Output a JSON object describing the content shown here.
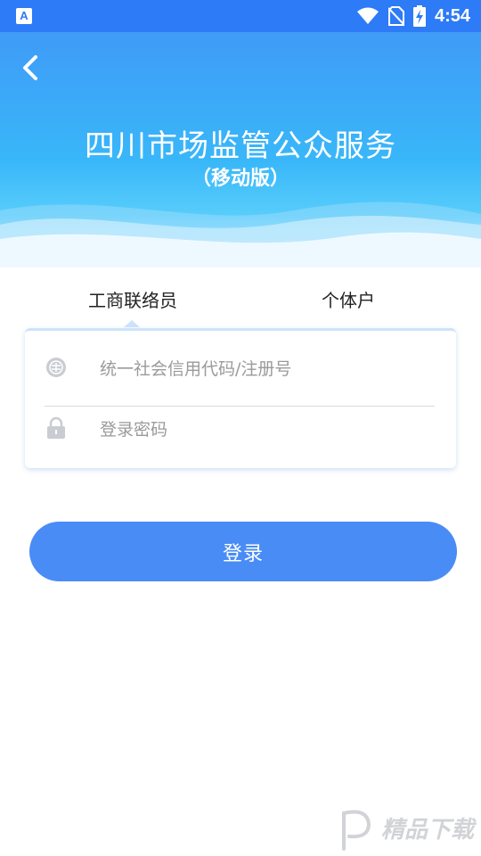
{
  "status_bar": {
    "app_icon_letter": "A",
    "time": "4:54",
    "icons": [
      "wifi-icon",
      "no-sim-icon",
      "battery-charging-icon"
    ]
  },
  "header": {
    "back_icon": "chevron-left-icon",
    "title": "四川市场监管公众服务",
    "subtitle": "（移动版）"
  },
  "tabs": {
    "items": [
      {
        "label": "工商联络员",
        "active": true
      },
      {
        "label": "个体户",
        "active": false
      }
    ]
  },
  "form": {
    "code_field": {
      "icon": "registration-seal-icon",
      "placeholder": "统一社会信用代码/注册号",
      "value": ""
    },
    "password_field": {
      "icon": "lock-icon",
      "placeholder": "登录密码",
      "value": ""
    }
  },
  "actions": {
    "login_label": "登录"
  },
  "colors": {
    "status_bar": "#2d7bf6",
    "primary_button": "#4a8cf6",
    "header_gradient_top": "#3f9bf7",
    "header_gradient_mid": "#39b7f9"
  },
  "watermark": {
    "text": "精品下载"
  }
}
